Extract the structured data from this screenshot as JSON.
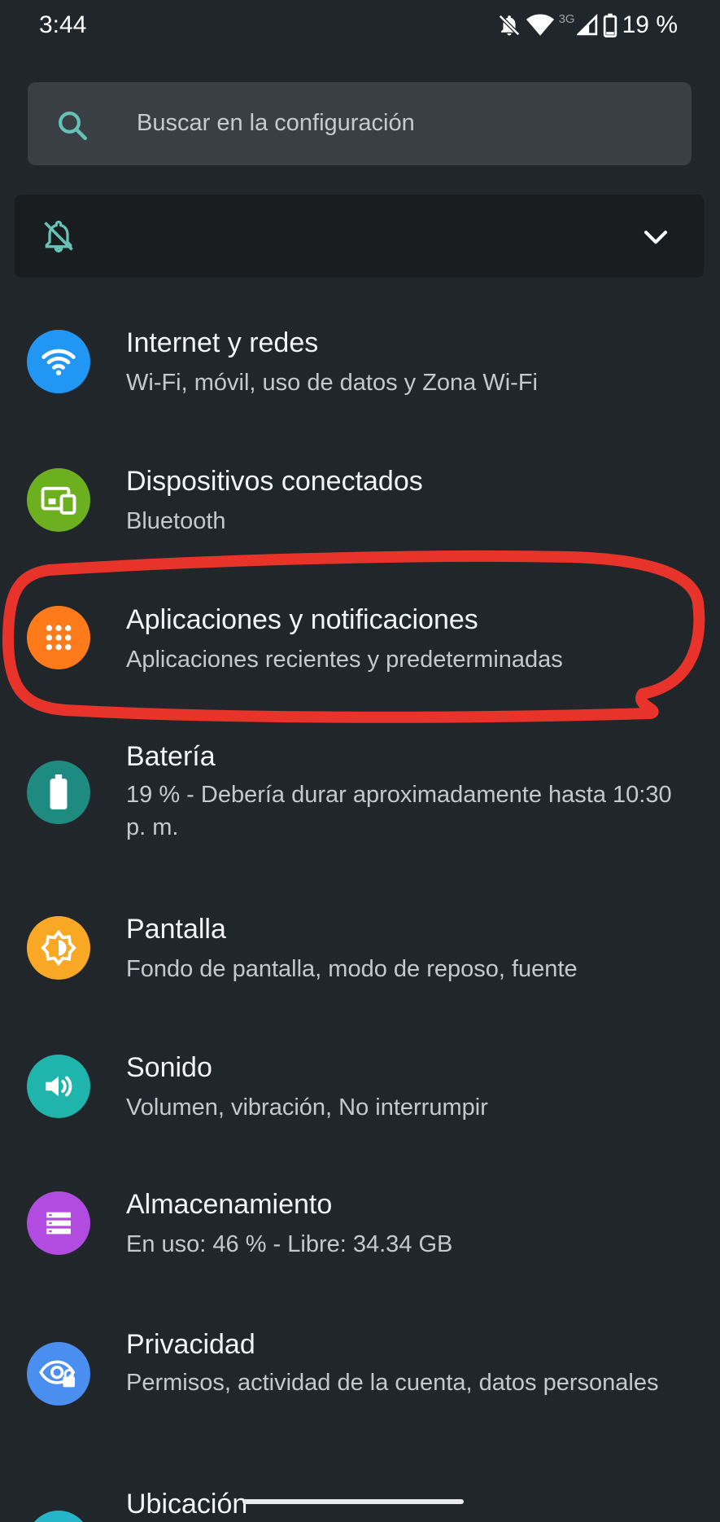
{
  "status_bar": {
    "time": "3:44",
    "network_type": "3G",
    "battery": "19 %",
    "icons": [
      "notifications-off-icon",
      "wifi-icon",
      "signal-icon",
      "battery-icon"
    ]
  },
  "search": {
    "placeholder": "Buscar en la configuración"
  },
  "dnd_card": {
    "icon": "notifications-off-icon",
    "chevron": "chevron-down-icon"
  },
  "items": [
    {
      "title": "Internet y redes",
      "subtitle": "Wi-Fi, móvil, uso de datos y Zona Wi-Fi",
      "icon": "wifi-icon",
      "color": "#2196f3"
    },
    {
      "title": "Dispositivos conectados",
      "subtitle": "Bluetooth",
      "icon": "devices-icon",
      "color": "#6cb01f"
    },
    {
      "title": "Aplicaciones y notificaciones",
      "subtitle": "Aplicaciones recientes y predeterminadas",
      "icon": "apps-grid-icon",
      "color": "#ff7a1a"
    },
    {
      "title": "Batería",
      "subtitle": "19 % - Debería durar aproximadamente hasta 10:30 p. m.",
      "icon": "battery-icon",
      "color": "#1f8a80"
    },
    {
      "title": "Pantalla",
      "subtitle": "Fondo de pantalla, modo de reposo, fuente",
      "icon": "brightness-icon",
      "color": "#f9a825"
    },
    {
      "title": "Sonido",
      "subtitle": "Volumen, vibración, No interrumpir",
      "icon": "volume-icon",
      "color": "#1fb5ad"
    },
    {
      "title": "Almacenamiento",
      "subtitle": "En uso: 46 % - Libre: 34.34 GB",
      "icon": "storage-icon",
      "color": "#b24be0"
    },
    {
      "title": "Privacidad",
      "subtitle": "Permisos, actividad de la cuenta, datos personales",
      "icon": "privacy-eye-icon",
      "color": "#4a8ef0"
    },
    {
      "title": "Ubicación",
      "subtitle": "",
      "icon": "location-icon",
      "color": "#24b5c9"
    }
  ],
  "colors": {
    "background": "#21262b",
    "annotation": "#e8332a",
    "accent_teal": "#66c2b7"
  }
}
